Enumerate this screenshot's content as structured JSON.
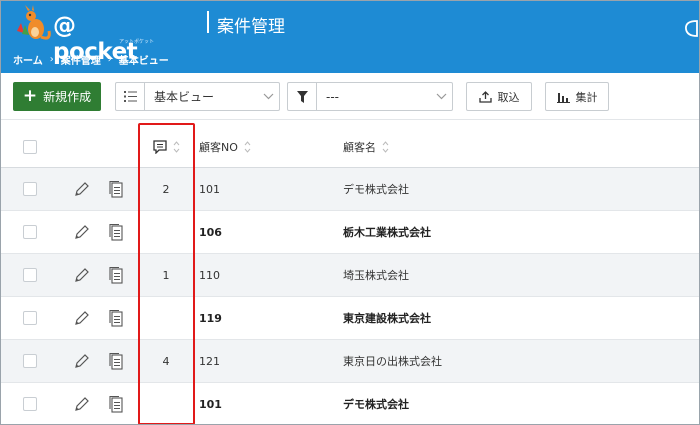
{
  "header": {
    "logo_text": "@ pocket",
    "logo_sub": "アットポケット",
    "title": "案件管理",
    "breadcrumb": [
      "ホーム",
      "案件管理",
      "基本ビュー"
    ],
    "colors": {
      "brand": "#1e8bd4",
      "accent_green": "#2f7d33",
      "highlight": "#e11919"
    }
  },
  "toolbar": {
    "new_label": "新規作成",
    "view_select": {
      "value": "基本ビュー",
      "lead_icon": "list-icon"
    },
    "filter_select": {
      "value": "---",
      "lead_icon": "filter-icon"
    },
    "import_label": "取込",
    "stats_label": "集計"
  },
  "table": {
    "headers": {
      "comment": "comment-icon",
      "no": "顧客NO",
      "name": "顧客名"
    },
    "rows": [
      {
        "comments": "2",
        "no": "101",
        "name": "デモ株式会社",
        "bold": false,
        "shade": true
      },
      {
        "comments": "",
        "no": "106",
        "name": "栃木工業株式会社",
        "bold": true,
        "shade": false
      },
      {
        "comments": "1",
        "no": "110",
        "name": "埼玉株式会社",
        "bold": false,
        "shade": true
      },
      {
        "comments": "",
        "no": "119",
        "name": "東京建設株式会社",
        "bold": true,
        "shade": false
      },
      {
        "comments": "4",
        "no": "121",
        "name": "東京日の出株式会社",
        "bold": false,
        "shade": true
      },
      {
        "comments": "",
        "no": "101",
        "name": "デモ株式会社",
        "bold": true,
        "shade": false
      }
    ]
  }
}
